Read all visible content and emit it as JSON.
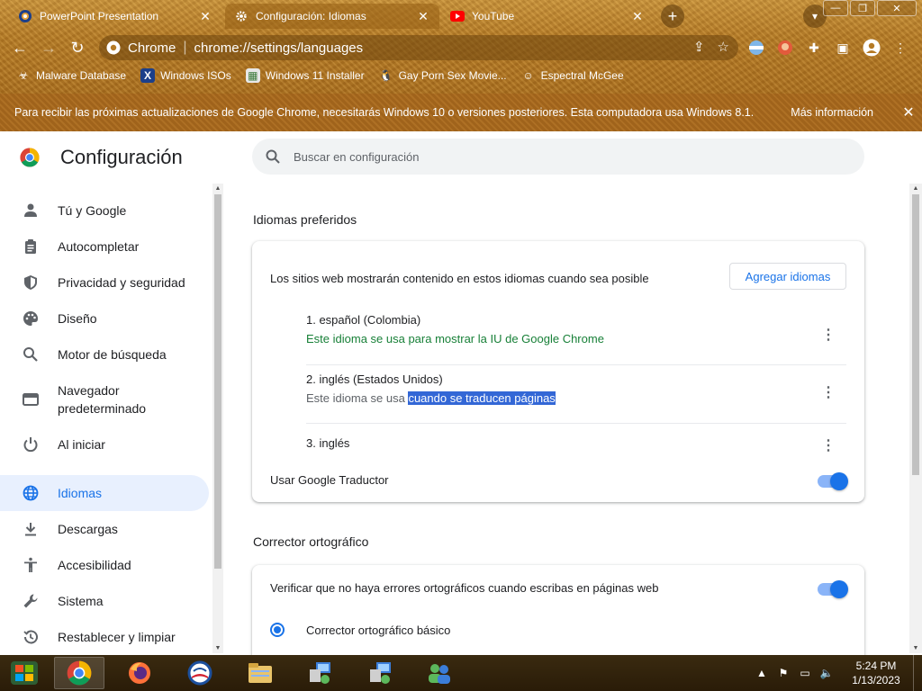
{
  "browser": {
    "tabs": [
      {
        "title": "PowerPoint Presentation",
        "icon": "powerpoint-icon"
      },
      {
        "title": "Configuración: Idiomas",
        "icon": "gear-icon"
      },
      {
        "title": "YouTube",
        "icon": "youtube-icon"
      }
    ],
    "omnibox": {
      "site_label": "Chrome",
      "url": "chrome://settings/languages"
    },
    "bookmarks": [
      {
        "label": "Malware Database",
        "icon": "biohazard-icon"
      },
      {
        "label": "Windows ISOs",
        "icon": "x-logo-icon"
      },
      {
        "label": "Windows 11 Installer",
        "icon": "image-icon"
      },
      {
        "label": "Gay Porn Sex Movie...",
        "icon": "tux-icon"
      },
      {
        "label": "Espectral McGee",
        "icon": "avatar-icon"
      }
    ],
    "infobar": {
      "message": "Para recibir las próximas actualizaciones de Google Chrome, necesitarás Windows 10 o versiones posteriores. Esta computadora usa Windows 8.1.",
      "link": "Más información"
    }
  },
  "settings": {
    "title": "Configuración",
    "search_placeholder": "Buscar en configuración",
    "nav": [
      {
        "label": "Tú y Google",
        "icon": "person-icon"
      },
      {
        "label": "Autocompletar",
        "icon": "clipboard-icon"
      },
      {
        "label": "Privacidad y seguridad",
        "icon": "shield-icon"
      },
      {
        "label": "Diseño",
        "icon": "palette-icon"
      },
      {
        "label": "Motor de búsqueda",
        "icon": "search-icon"
      },
      {
        "label": "Navegador predeterminado",
        "icon": "browser-icon"
      },
      {
        "label": "Al iniciar",
        "icon": "power-icon"
      },
      {
        "label": "Idiomas",
        "icon": "globe-icon",
        "active": true
      },
      {
        "label": "Descargas",
        "icon": "download-icon"
      },
      {
        "label": "Accesibilidad",
        "icon": "accessibility-icon"
      },
      {
        "label": "Sistema",
        "icon": "wrench-icon"
      },
      {
        "label": "Restablecer y limpiar",
        "icon": "history-icon"
      }
    ],
    "preferred": {
      "section_title": "Idiomas preferidos",
      "description": "Los sitios web mostrarán contenido en estos idiomas cuando sea posible",
      "add_button": "Agregar idiomas",
      "languages": [
        {
          "name": "1. español (Colombia)",
          "note": "Este idioma se usa para mostrar la IU de Google Chrome"
        },
        {
          "name": "2. inglés (Estados Unidos)",
          "note_prefix": "Este idioma se usa ",
          "note_highlight": "cuando se traducen páginas"
        },
        {
          "name": "3. inglés"
        }
      ],
      "translate_toggle_label": "Usar Google Traductor",
      "translate_enabled": true
    },
    "spellcheck": {
      "section_title": "Corrector ortográfico",
      "toggle_label": "Verificar que no haya errores ortográficos cuando escribas en páginas web",
      "enabled": true,
      "option_basic": "Corrector ortográfico básico"
    }
  },
  "taskbar": {
    "clock_time": "5:24 PM",
    "clock_date": "1/13/2023"
  },
  "colors": {
    "accent": "#1a73e8",
    "active_nav_bg": "#e8f0fe",
    "ui_language_note": "#188038",
    "theme_brown": "#b57a25"
  }
}
